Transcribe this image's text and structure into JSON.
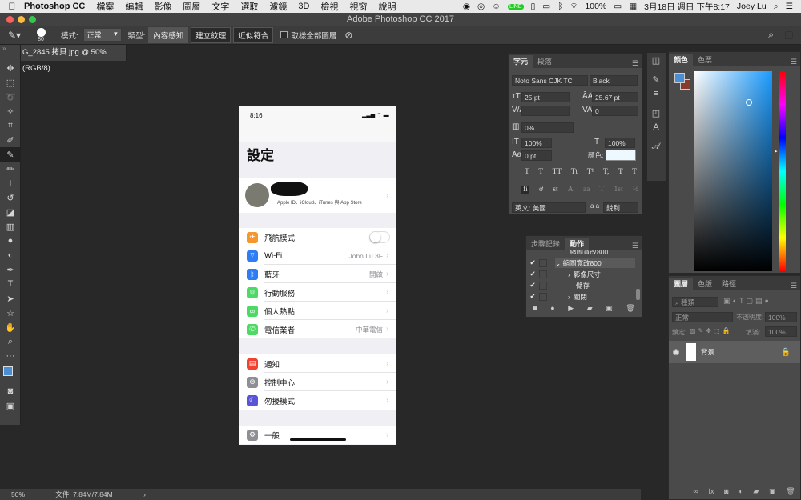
{
  "menubar": {
    "app": "Photoshop CC",
    "items": [
      "檔案",
      "編輯",
      "影像",
      "圖層",
      "文字",
      "選取",
      "濾鏡",
      "3D",
      "檢視",
      "視窗",
      "說明"
    ],
    "battery": "100%",
    "datetime": "3月18日 週日 下午8:17",
    "user": "Joey Lu"
  },
  "window": {
    "title": "Adobe Photoshop CC 2017"
  },
  "options": {
    "brush_size": "80",
    "mode_label": "模式:",
    "mode_value": "正常",
    "type_label": "類型:",
    "type_buttons": [
      "內容感知",
      "建立紋理",
      "近似符合"
    ],
    "sample_all": "取樣全部圖層"
  },
  "document": {
    "tab": "G_2845 拷貝.jpg @ 50% (RGB/8)",
    "zoom": "50%",
    "file_info": "文件: 7.84M/7.84M"
  },
  "phone": {
    "time": "8:16",
    "title": "設定",
    "apple_id": "Apple ID、iCloud、iTunes 與 App Store",
    "group1": [
      {
        "label": "飛航模式",
        "value": "",
        "color": "#f7962c",
        "icon": "airplane-icon"
      },
      {
        "label": "Wi-Fi",
        "value": "John Lu 3F",
        "color": "#2e7cf6",
        "icon": "wifi-icon"
      },
      {
        "label": "藍牙",
        "value": "開啟",
        "color": "#2e7cf6",
        "icon": "bluetooth-icon"
      },
      {
        "label": "行動服務",
        "value": "",
        "color": "#4cd964",
        "icon": "antenna-icon"
      },
      {
        "label": "個人熱點",
        "value": "",
        "color": "#4cd964",
        "icon": "hotspot-icon"
      },
      {
        "label": "電信業者",
        "value": "中華電信",
        "color": "#4cd964",
        "icon": "phone-icon"
      }
    ],
    "group2": [
      {
        "label": "通知",
        "color": "#f2412f",
        "icon": "notification-icon"
      },
      {
        "label": "控制中心",
        "color": "#8e8e93",
        "icon": "control-center-icon"
      },
      {
        "label": "勿擾模式",
        "color": "#5856d6",
        "icon": "moon-icon"
      }
    ],
    "group3": [
      {
        "label": "一般",
        "color": "#8e8e93",
        "icon": "gear-icon"
      }
    ]
  },
  "character": {
    "tabs": [
      "字元",
      "段落"
    ],
    "font_family": "Noto Sans CJK TC",
    "font_style": "Black",
    "size": "25 pt",
    "leading": "25.67 pt",
    "tracking": "0",
    "scale_pct": "0%",
    "vscale": "100%",
    "hscale": "100%",
    "baseline": "0 pt",
    "color_label": "顏色:",
    "language": "英文: 美國",
    "antialias": "銳利",
    "antialias_icon": "a a",
    "style_buttons": [
      "T",
      "T",
      "TT",
      "Tt",
      "T¹",
      "T,",
      "T",
      "T"
    ],
    "ot_buttons": [
      "fi",
      "ơ",
      "st",
      "A",
      "aa",
      "T",
      "1st",
      "½"
    ]
  },
  "actions": {
    "tabs": [
      "步驟記錄",
      "動作"
    ],
    "rows": [
      "縮圖寬改800",
      "縮圖寬改800",
      "影像尺寸",
      "儲存",
      "關閉"
    ]
  },
  "color": {
    "tabs": [
      "顏色",
      "色票"
    ],
    "fg": "#4a8fd4",
    "bg": "#8a3a2a",
    "hue": "#1a9bff"
  },
  "layers": {
    "tabs": [
      "圖層",
      "色版",
      "路徑"
    ],
    "kind": "種類",
    "blend": "正常",
    "opacity_label": "不透明度:",
    "opacity": "100%",
    "lock_label": "鎖定:",
    "fill_label": "填滿:",
    "fill": "100%",
    "layer_name": "背景"
  }
}
